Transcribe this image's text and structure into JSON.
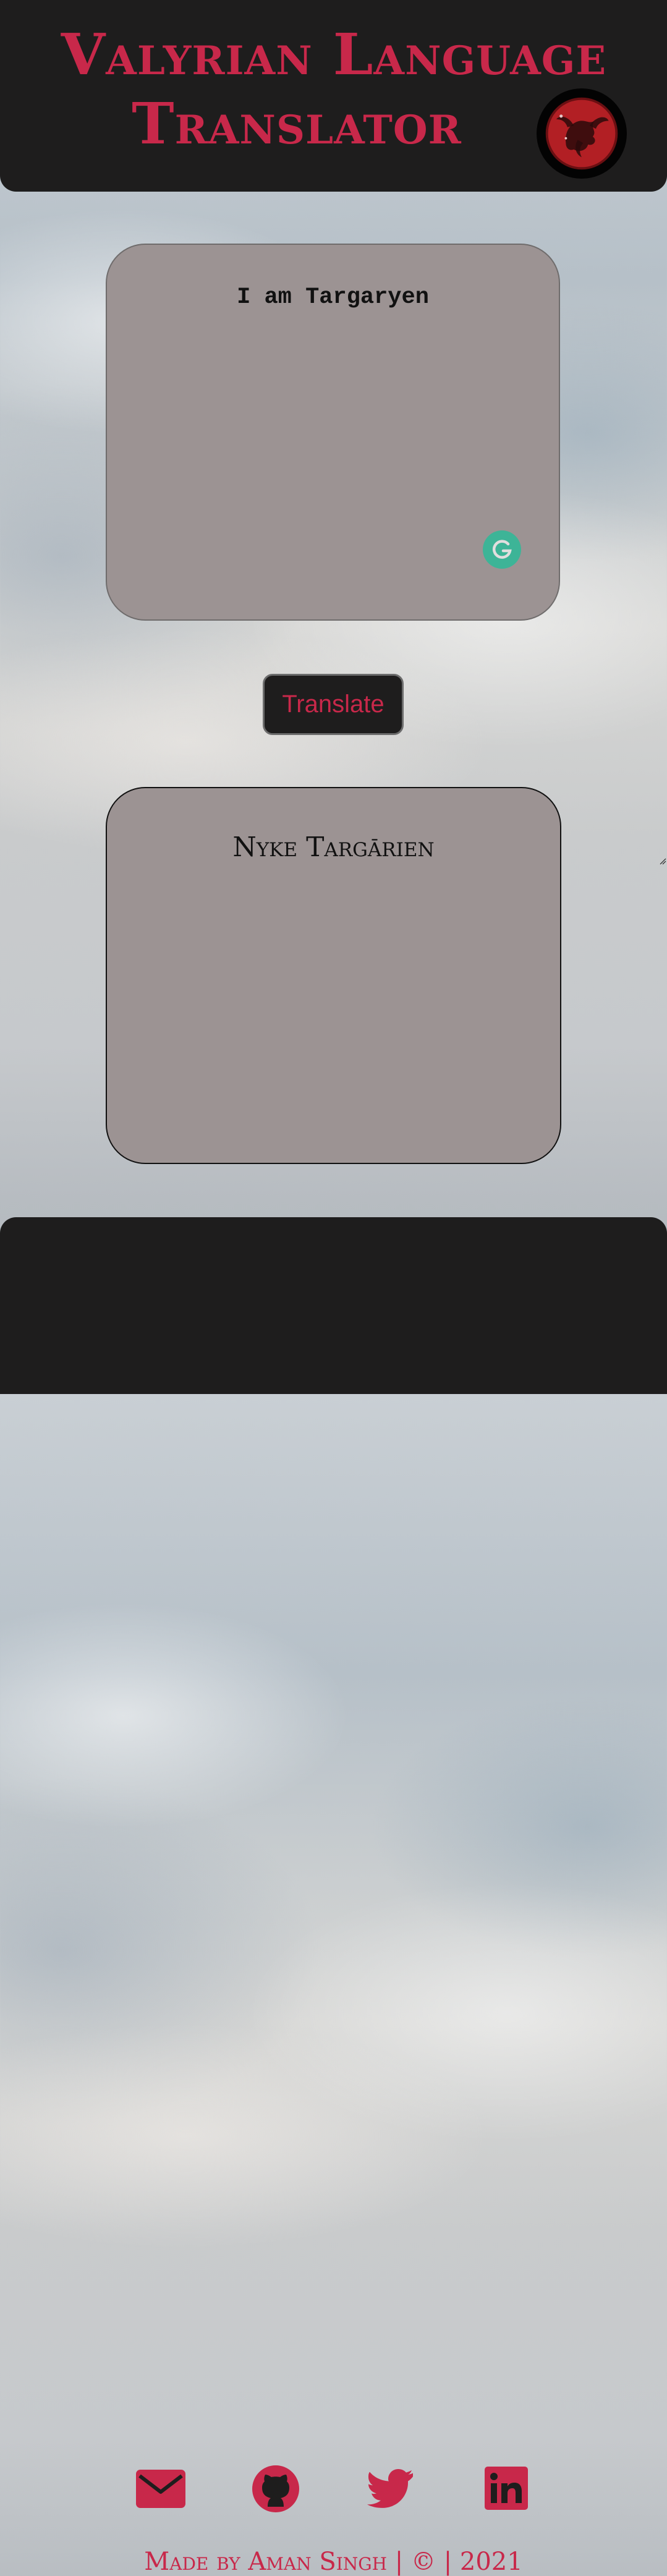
{
  "theme": {
    "accent": "#c8284a",
    "panel": "#1e1d1d",
    "textbox": "#9c9393"
  },
  "header": {
    "title_line1": "Valyrian Language",
    "title_line2": "Translator",
    "logo_icon": "house-targaryen-dragon-sigil-icon"
  },
  "input": {
    "value": "I am Targaryen",
    "grammarly_icon": "grammarly-icon"
  },
  "button": {
    "label": "Translate"
  },
  "output": {
    "value": "Nyke Targārien"
  },
  "footer": {
    "icons": [
      "mail-icon",
      "github-icon",
      "twitter-icon",
      "linkedin-icon"
    ],
    "credit": "Made by Aman Singh | © | 2021"
  }
}
